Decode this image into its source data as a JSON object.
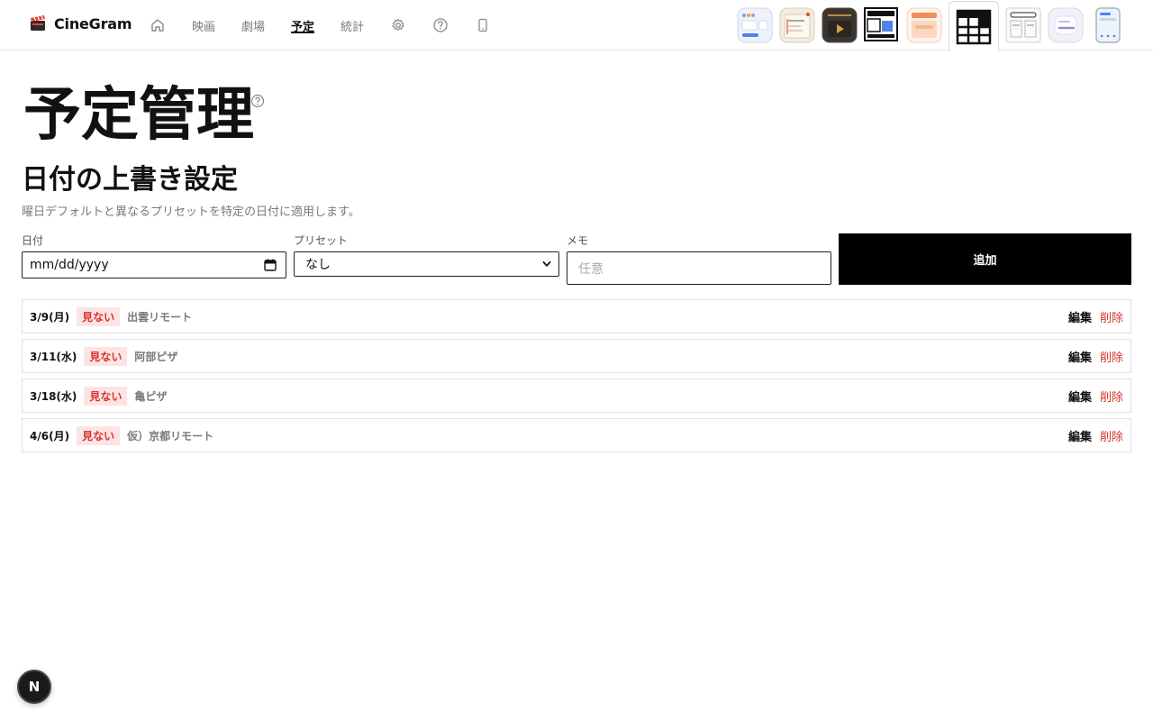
{
  "app": {
    "brand_name": "CineGram"
  },
  "nav": {
    "items": [
      {
        "label": "映画",
        "active": false
      },
      {
        "label": "劇場",
        "active": false
      },
      {
        "label": "予定",
        "active": true
      },
      {
        "label": "統計",
        "active": false
      }
    ]
  },
  "themes": [
    "theme-soft-blue",
    "theme-paper",
    "theme-dark-player",
    "theme-blocks",
    "theme-warm",
    "theme-grid",
    "theme-wire",
    "theme-lavender",
    "theme-mobile"
  ],
  "page": {
    "title": "予定管理"
  },
  "section": {
    "title": "日付の上書き設定",
    "description": "曜日デフォルトと異なるプリセットを特定の日付に適用します。"
  },
  "form": {
    "date_label": "日付",
    "date_placeholder": "mm/dd/yyyy",
    "preset_label": "プリセット",
    "preset_value": "なし",
    "memo_label": "メモ",
    "memo_placeholder": "任意",
    "add_label": "追加"
  },
  "overrides": [
    {
      "date": "3/9(月)",
      "status": "見ない",
      "memo": "出雲リモート"
    },
    {
      "date": "3/11(水)",
      "status": "見ない",
      "memo": "阿部ピザ"
    },
    {
      "date": "3/18(水)",
      "status": "見ない",
      "memo": "亀ピザ"
    },
    {
      "date": "4/6(月)",
      "status": "見ない",
      "memo": "仮）京都リモート"
    }
  ],
  "row_actions": {
    "edit": "編集",
    "delete": "削除"
  },
  "floating": {
    "label": "N"
  },
  "colors": {
    "accent": "#000000",
    "danger": "#d6342d",
    "badge_bg": "#fde4e4"
  }
}
